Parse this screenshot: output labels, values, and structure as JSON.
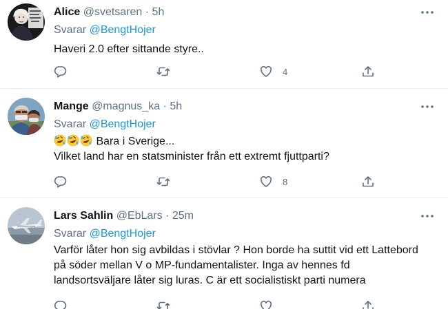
{
  "tweets": [
    {
      "name": "Alice",
      "handle": "@svetsaren",
      "separator": "·",
      "time": "5h",
      "replying_prefix": "Svarar",
      "replying_to": "@BengtHojer",
      "lines": [
        "Haveri 2.0 efter sittande styre.."
      ],
      "likes": "4"
    },
    {
      "name": "Mange",
      "handle": "@magnus_ka",
      "separator": "·",
      "time": "5h",
      "replying_prefix": "Svarar",
      "replying_to": "@BengtHojer",
      "emoji_line_text": "Bara i Sverige...",
      "emoji_count_name": "rolling-on-floor-laughing",
      "lines": [
        "Vilket land har en statsminister från ett extremt fjuttparti?"
      ],
      "likes": "8"
    },
    {
      "name": "Lars Sahlin",
      "handle": "@EbLars",
      "separator": "·",
      "time": "25m",
      "replying_prefix": "Svarar",
      "replying_to": "@BengtHojer",
      "lines": [
        "Varför låter hon sig avbildas i stövlar ? Hon borde ha suttit vid ett Lattebord",
        "på söder mellan V o MP-fundamentalister. Inga av hennes fd",
        "landsortsväljare låter sig luras. C är ett socialistiskt parti numera"
      ],
      "likes": ""
    }
  ],
  "colors": {
    "text": "#0f1419",
    "secondary": "#5b7083",
    "link": "#1b95e0",
    "divider": "#ebeef0"
  },
  "icons": [
    "more-icon",
    "reply-icon",
    "retweet-icon",
    "like-icon",
    "share-icon"
  ]
}
